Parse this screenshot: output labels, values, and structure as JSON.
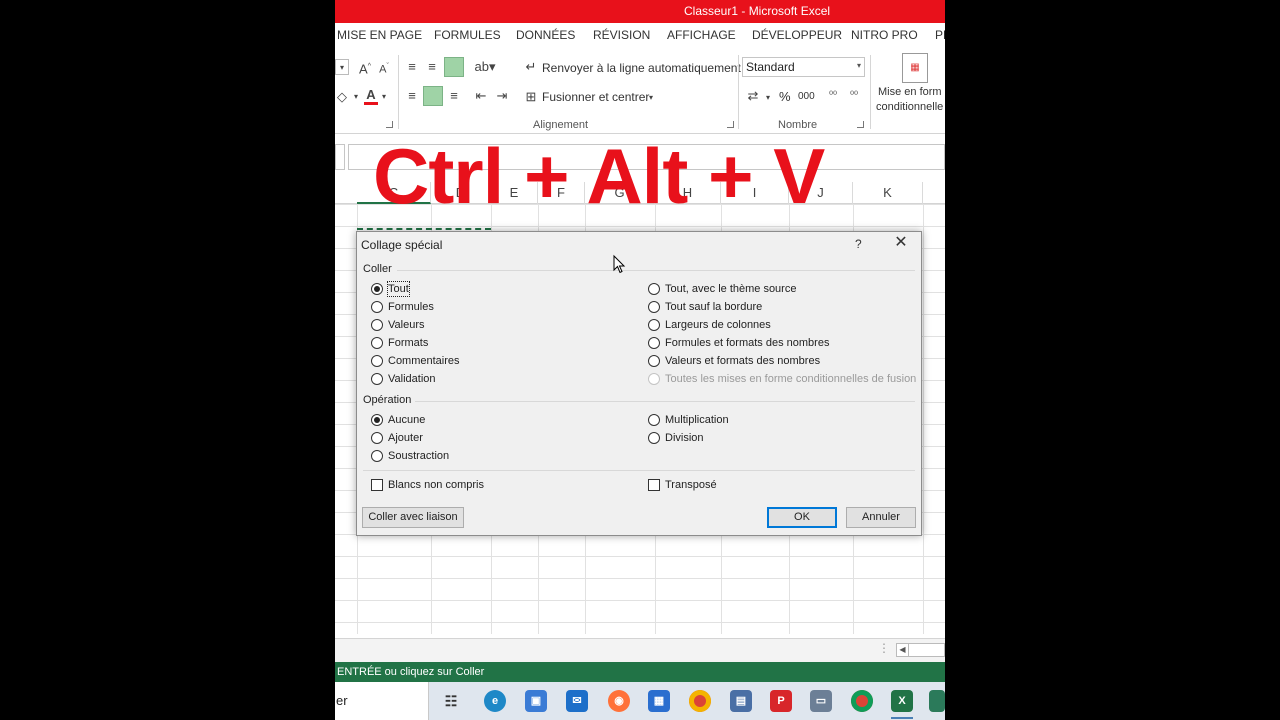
{
  "window": {
    "title": "Classeur1 -  Microsoft Excel"
  },
  "ribbon_tabs": [
    "MISE EN PAGE",
    "FORMULES",
    "DONNÉES",
    "RÉVISION",
    "AFFICHAGE",
    "DÉVELOPPEUR",
    "NITRO PRO",
    "PD"
  ],
  "ribbon": {
    "wrap_text": "Renvoyer à la ligne automatiquement",
    "merge_center": "Fusionner et centrer",
    "alignment_group": "Alignement",
    "number_format_value": "Standard",
    "number_group": "Nombre",
    "percent": "%",
    "thousands": "000",
    "cond_format_line1": "Mise en form",
    "cond_format_line2": "conditionnelle"
  },
  "overlay_text": "Ctrl + Alt + V",
  "columns": [
    "C",
    "D",
    "E",
    "F",
    "G",
    "H",
    "I",
    "J",
    "K"
  ],
  "dialog": {
    "title": "Collage spécial",
    "help": "?",
    "close": "✕",
    "paste_section": "Coller",
    "paste_options_left": [
      "Tout",
      "Formules",
      "Valeurs",
      "Formats",
      "Commentaires",
      "Validation"
    ],
    "paste_options_right": [
      "Tout, avec le thème source",
      "Tout sauf la bordure",
      "Largeurs de colonnes",
      "Formules et formats des nombres",
      "Valeurs et formats des nombres",
      "Toutes les mises en forme conditionnelles de fusion"
    ],
    "paste_selected": "Tout",
    "operation_section": "Opération",
    "operation_left": [
      "Aucune",
      "Ajouter",
      "Soustraction"
    ],
    "operation_right": [
      "Multiplication",
      "Division"
    ],
    "operation_selected": "Aucune",
    "skip_blanks": "Blancs non compris",
    "transpose": "Transposé",
    "paste_link_button": "Coller avec liaison",
    "ok_button": "OK",
    "cancel_button": "Annuler"
  },
  "status_bar": "ENTRÉE ou cliquez sur Coller",
  "taskbar": {
    "search_stub": "er"
  },
  "colors": {
    "title_red": "#e8111b",
    "excel_green": "#217346",
    "overlay_red": "#e8111b"
  }
}
